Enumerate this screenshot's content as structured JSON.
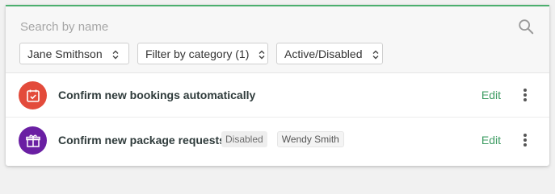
{
  "search": {
    "placeholder": "Search by name",
    "value": ""
  },
  "filters": {
    "user": "Jane Smithson",
    "category": "Filter by category (1)",
    "status": "Active/Disabled"
  },
  "rules": [
    {
      "title": "Confirm new bookings automatically",
      "icon": "calendar-check-icon",
      "icon_color": "#e34b3b",
      "badges": [],
      "edit_label": "Edit"
    },
    {
      "title": "Confirm new package requests",
      "icon": "gift-icon",
      "icon_color": "#6a1fa3",
      "badges": [
        "Disabled",
        "Wendy Smith"
      ],
      "edit_label": "Edit"
    }
  ],
  "colors": {
    "accent": "#4caf6e",
    "edit_link": "#3e9c63"
  }
}
